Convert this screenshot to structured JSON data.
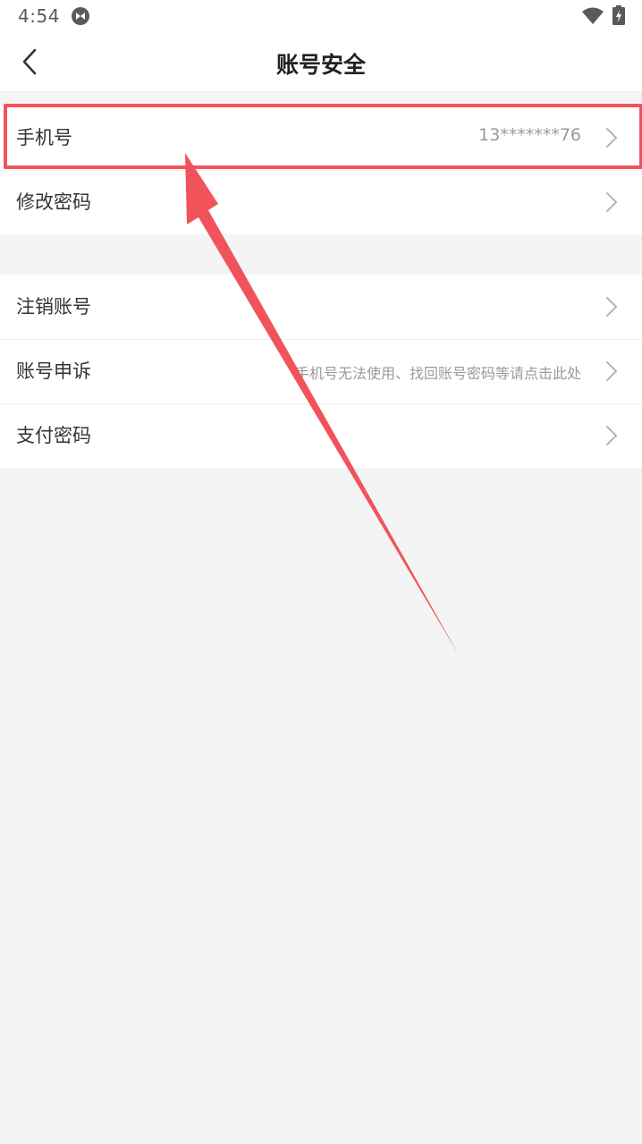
{
  "status_bar": {
    "time": "4:54",
    "app_icon": "app-notification-icon",
    "wifi_icon": "wifi-icon",
    "battery_icon": "battery-charging-icon"
  },
  "nav": {
    "back_icon": "back-arrow-icon",
    "title": "账号安全"
  },
  "group1": [
    {
      "label": "手机号",
      "value": "13*******76"
    },
    {
      "label": "修改密码",
      "value": ""
    }
  ],
  "group2": [
    {
      "label": "注销账号",
      "value": ""
    },
    {
      "label": "账号申诉",
      "value": "手机号无法使用、找回账号密码等请点击此处"
    },
    {
      "label": "支付密码",
      "value": ""
    }
  ],
  "colors": {
    "highlight": "#f0545a",
    "background": "#f4f4f4",
    "row_bg": "#ffffff",
    "hint_text": "#9a9a9a"
  }
}
